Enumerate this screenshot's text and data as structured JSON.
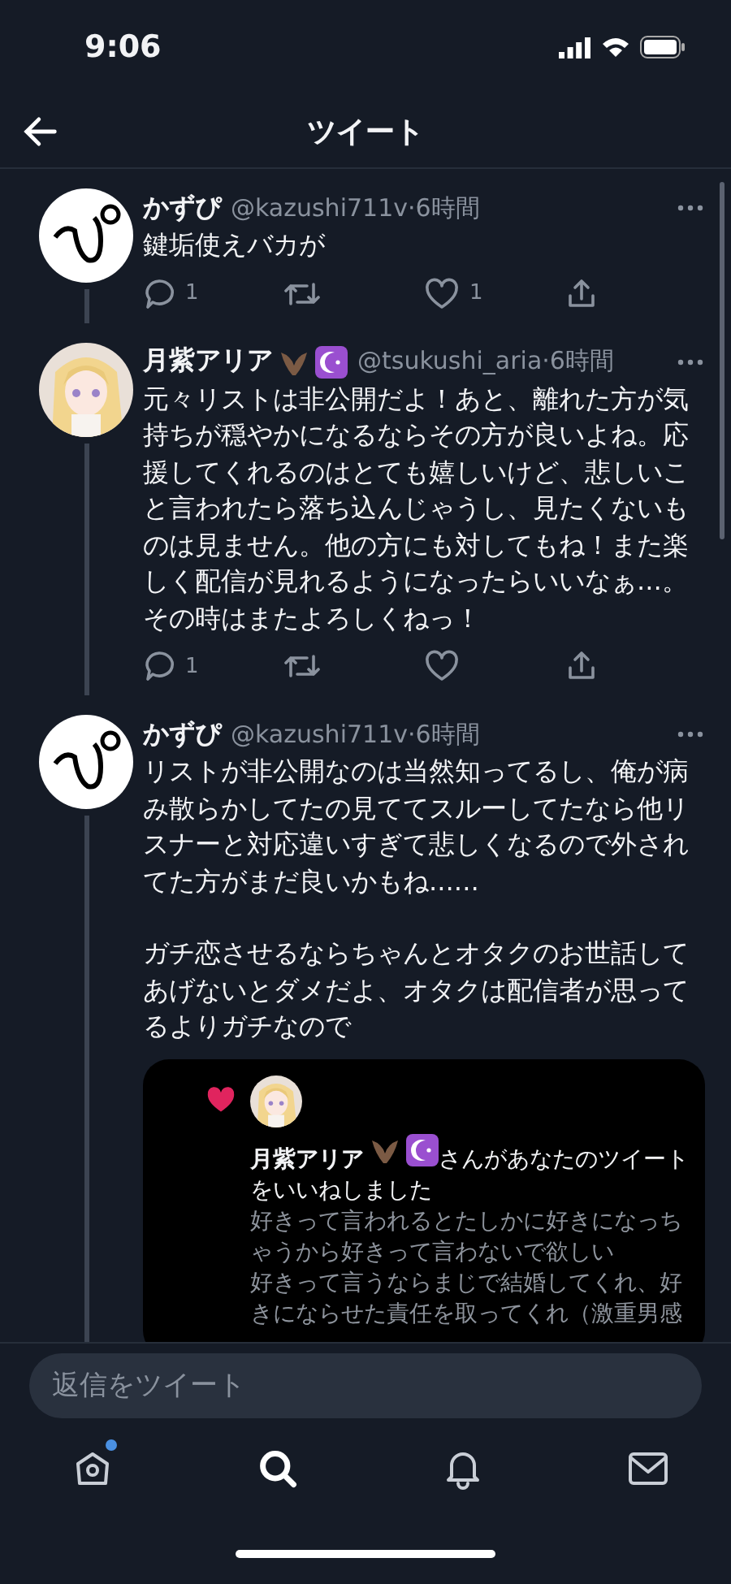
{
  "status_bar": {
    "time": "9:06"
  },
  "header": {
    "title": "ツイート"
  },
  "tweets": [
    {
      "author": {
        "name": "かずぴ",
        "badges": false,
        "meta": "@kazushi711v·6時間"
      },
      "paragraphs": [
        "鍵垢使えバカが"
      ],
      "actions": {
        "replies": "1",
        "likes": "1",
        "liked": false
      }
    },
    {
      "author": {
        "name": "月紫アリア",
        "badges": true,
        "meta": "@tsukushi_aria·6時間"
      },
      "paragraphs": [
        "元々リストは非公開だよ！あと、離れた方が気持ちが穏やかになるならその方が良いよね。応援してくれるのはとても嬉しいけど、悲しいこと言われたら落ち込んじゃうし、見たくないものは見ません。他の方にも対してもね！また楽しく配信が見れるようになったらいいなぁ...。その時はまたよろしくねっ！"
      ],
      "actions": {
        "replies": "1",
        "liked": false
      }
    },
    {
      "author": {
        "name": "かずぴ",
        "badges": false,
        "meta": "@kazushi711v·6時間"
      },
      "paragraphs": [
        "リストが非公開なのは当然知ってるし、俺が病み散らかしてたの見ててスルーしてたなら他リスナーと対応違いすぎて悲しくなるので外されてた方がまだ良いかもね......",
        "ガチ恋させるならちゃんとオタクのお世話してあげないとダメだよ、オタクは配信者が思ってるよりガチなので"
      ],
      "attachment": {
        "kind": "liked_notification",
        "actor": "月紫アリア",
        "badges": true,
        "message": "さんがあなたのツイートをいいねしました",
        "lines": [
          "好きって言われるとたしかに好きになっちゃうから好きって言わないで欲しい",
          "好きって言うならまじで結婚してくれ、好きにならせた責任を取ってくれ（激重男感"
        ]
      }
    }
  ],
  "reply_field": {
    "placeholder": "返信をツイート"
  },
  "tab_bar": [
    {
      "kind": "home",
      "selected": false,
      "badge": true
    },
    {
      "kind": "search",
      "selected": true,
      "badge": false
    },
    {
      "kind": "bell",
      "selected": false,
      "badge": false
    },
    {
      "kind": "mail",
      "selected": false,
      "badge": false
    }
  ]
}
